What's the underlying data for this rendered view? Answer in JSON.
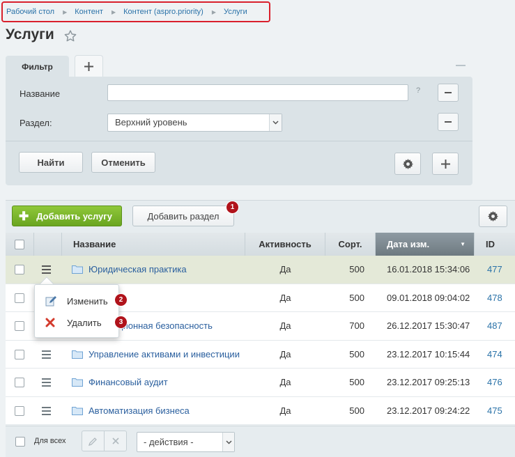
{
  "breadcrumb": [
    "Рабочий стол",
    "Контент",
    "Контент (aspro.priority)",
    "Услуги"
  ],
  "page": {
    "title": "Услуги"
  },
  "filter": {
    "tab_label": "Фильтр",
    "name_label": "Название",
    "name_value": "",
    "hint": "?",
    "section_label": "Раздел:",
    "section_value": "Верхний уровень",
    "find_button": "Найти",
    "cancel_button": "Отменить"
  },
  "toolbar": {
    "add_service": "Добавить услугу",
    "add_section": "Добавить раздел"
  },
  "columns": [
    "Название",
    "Активность",
    "Сорт.",
    "Дата изм.",
    "ID"
  ],
  "sorted_column": "Дата изм.",
  "rows": [
    {
      "name": "Юридическая практика",
      "active": "Да",
      "sort": "500",
      "date": "16.01.2018 15:34:06",
      "id": "477"
    },
    {
      "name": "",
      "active": "Да",
      "sort": "500",
      "date": "09.01.2018 09:04:02",
      "id": "478"
    },
    {
      "name": "ционная безопасность",
      "active": "Да",
      "sort": "700",
      "date": "26.12.2017 15:30:47",
      "id": "487"
    },
    {
      "name": "Управление активами и инвестиции",
      "active": "Да",
      "sort": "500",
      "date": "23.12.2017 10:15:44",
      "id": "474"
    },
    {
      "name": "Финансовый аудит",
      "active": "Да",
      "sort": "500",
      "date": "23.12.2017 09:25:13",
      "id": "476"
    },
    {
      "name": "Автоматизация бизнеса",
      "active": "Да",
      "sort": "500",
      "date": "23.12.2017 09:24:22",
      "id": "475"
    }
  ],
  "context_menu": {
    "edit": "Изменить",
    "delete": "Удалить"
  },
  "badges": [
    "1",
    "2",
    "3"
  ],
  "footer": {
    "select_all": "Для всех",
    "actions_value": "- действия -"
  },
  "colors": {
    "accent_green": "#6aa520",
    "badge_red": "#b0131b",
    "link_blue": "#2a5f9e",
    "highlight_red": "#d9202c"
  }
}
